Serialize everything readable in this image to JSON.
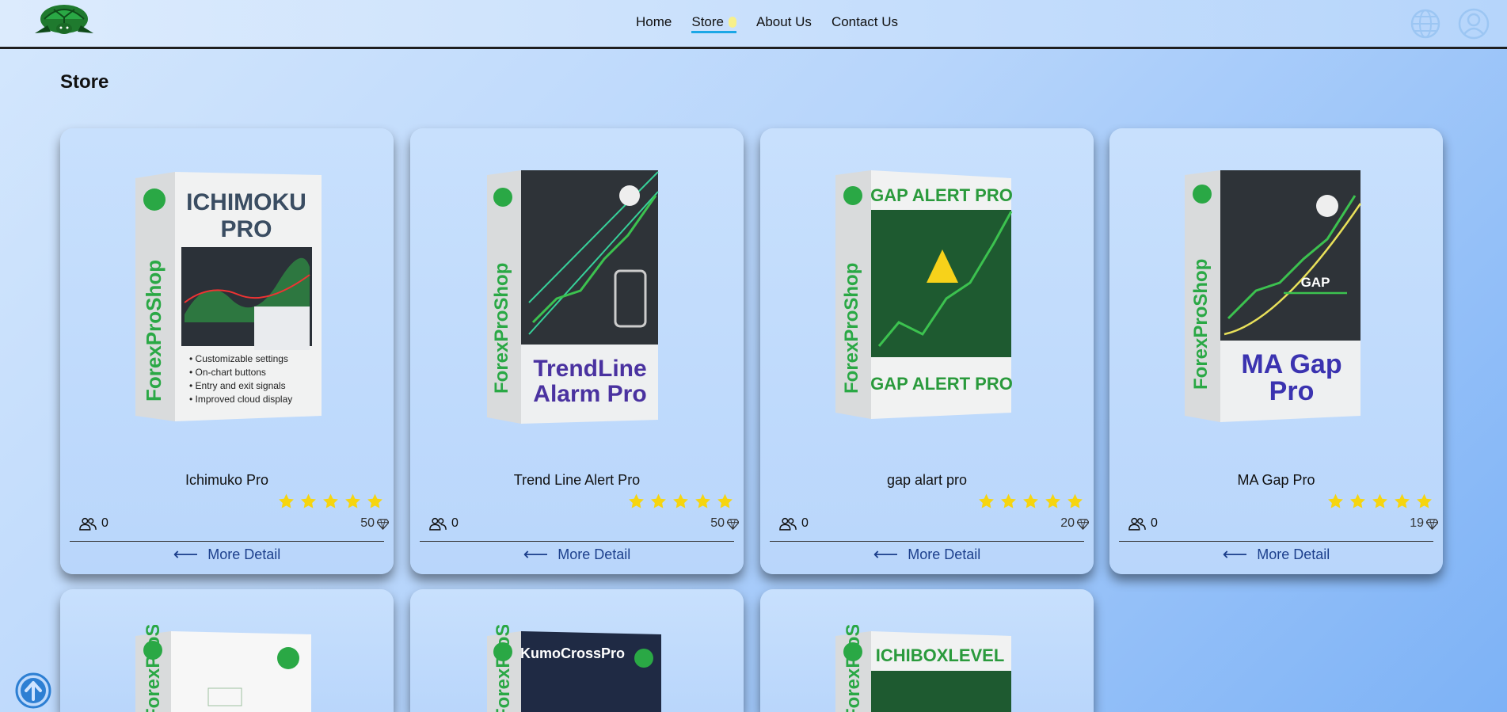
{
  "nav": {
    "links": [
      "Home",
      "Store",
      "About Us",
      "Contact Us"
    ],
    "active": "Store"
  },
  "icons": {
    "logo": "turtle-logo",
    "globe": "globe-icon",
    "user": "user-icon",
    "buyers": "users-icon",
    "price": "gem-icon",
    "star": "star-icon",
    "arrow": "arrow-left-icon",
    "scroll": "arrow-up-circle-icon"
  },
  "page": {
    "title": "Store"
  },
  "colors": {
    "accent": "#1ba7e6",
    "star": "#f6d50f",
    "link": "#1c3f8c",
    "brand_green": "#2aa845"
  },
  "products": [
    {
      "name": "Ichimuko Pro",
      "buyers": "0",
      "price": "50",
      "rating": 5,
      "detail_label": "More Detail",
      "box": {
        "spine": "ForexProShop",
        "title": "ICHIMOKU PRO",
        "bullets": [
          "Customizable settings",
          "On-chart buttons",
          "Entry and exit signals",
          "Improved cloud display"
        ]
      }
    },
    {
      "name": "Trend Line Alert Pro",
      "buyers": "0",
      "price": "50",
      "rating": 5,
      "detail_label": "More Detail",
      "box": {
        "spine": "ForexProShop",
        "title": "TrendLine Alarm Pro"
      }
    },
    {
      "name": "gap alart pro",
      "buyers": "0",
      "price": "20",
      "rating": 5,
      "detail_label": "More Detail",
      "box": {
        "spine": "ForexProShop",
        "title": "GAP ALERT PRO",
        "footer": "GAP ALERT PRO"
      }
    },
    {
      "name": "MA Gap Pro",
      "buyers": "0",
      "price": "19",
      "rating": 5,
      "detail_label": "More Detail",
      "box": {
        "spine": "ForexProShop",
        "title": "MA Gap Pro",
        "chart_label": "GAP"
      }
    }
  ],
  "second_row": [
    {
      "box": {
        "spine": "ForexProShop"
      }
    },
    {
      "box": {
        "spine": "ForexProShop",
        "title": "KumoCrossPro"
      }
    },
    {
      "box": {
        "spine": "ForexProShop",
        "title": "ICHIBOXLEVEL"
      }
    }
  ]
}
